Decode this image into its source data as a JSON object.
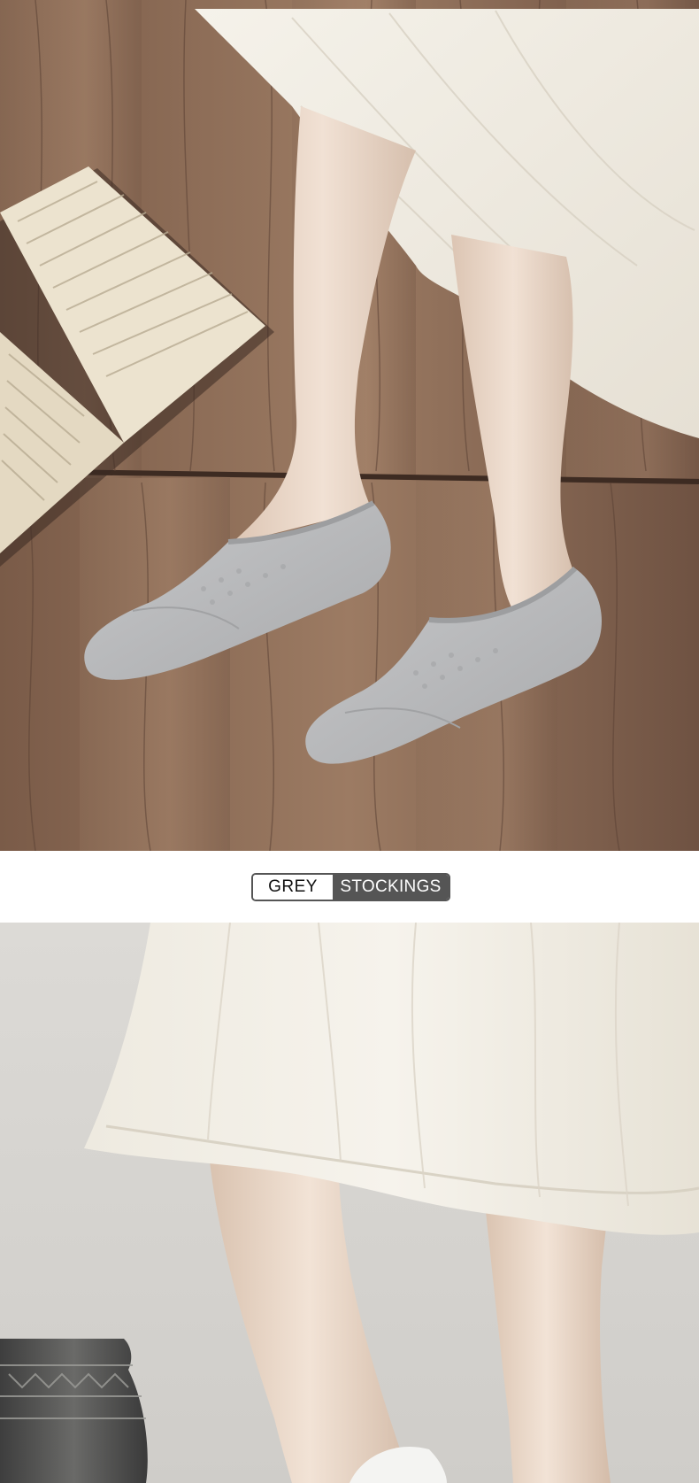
{
  "label": {
    "color_name": "GREY",
    "product_name": "STOCKINGS"
  },
  "palette": {
    "wood_dark": "#6f5242",
    "wood_light": "#a8866d",
    "skirt": "#f1ede4",
    "sock": "#b9babc",
    "skin": "#ead8c9",
    "book_page": "#ece3cf",
    "wall": "#d9d7d3",
    "badge_dark": "#555555"
  }
}
